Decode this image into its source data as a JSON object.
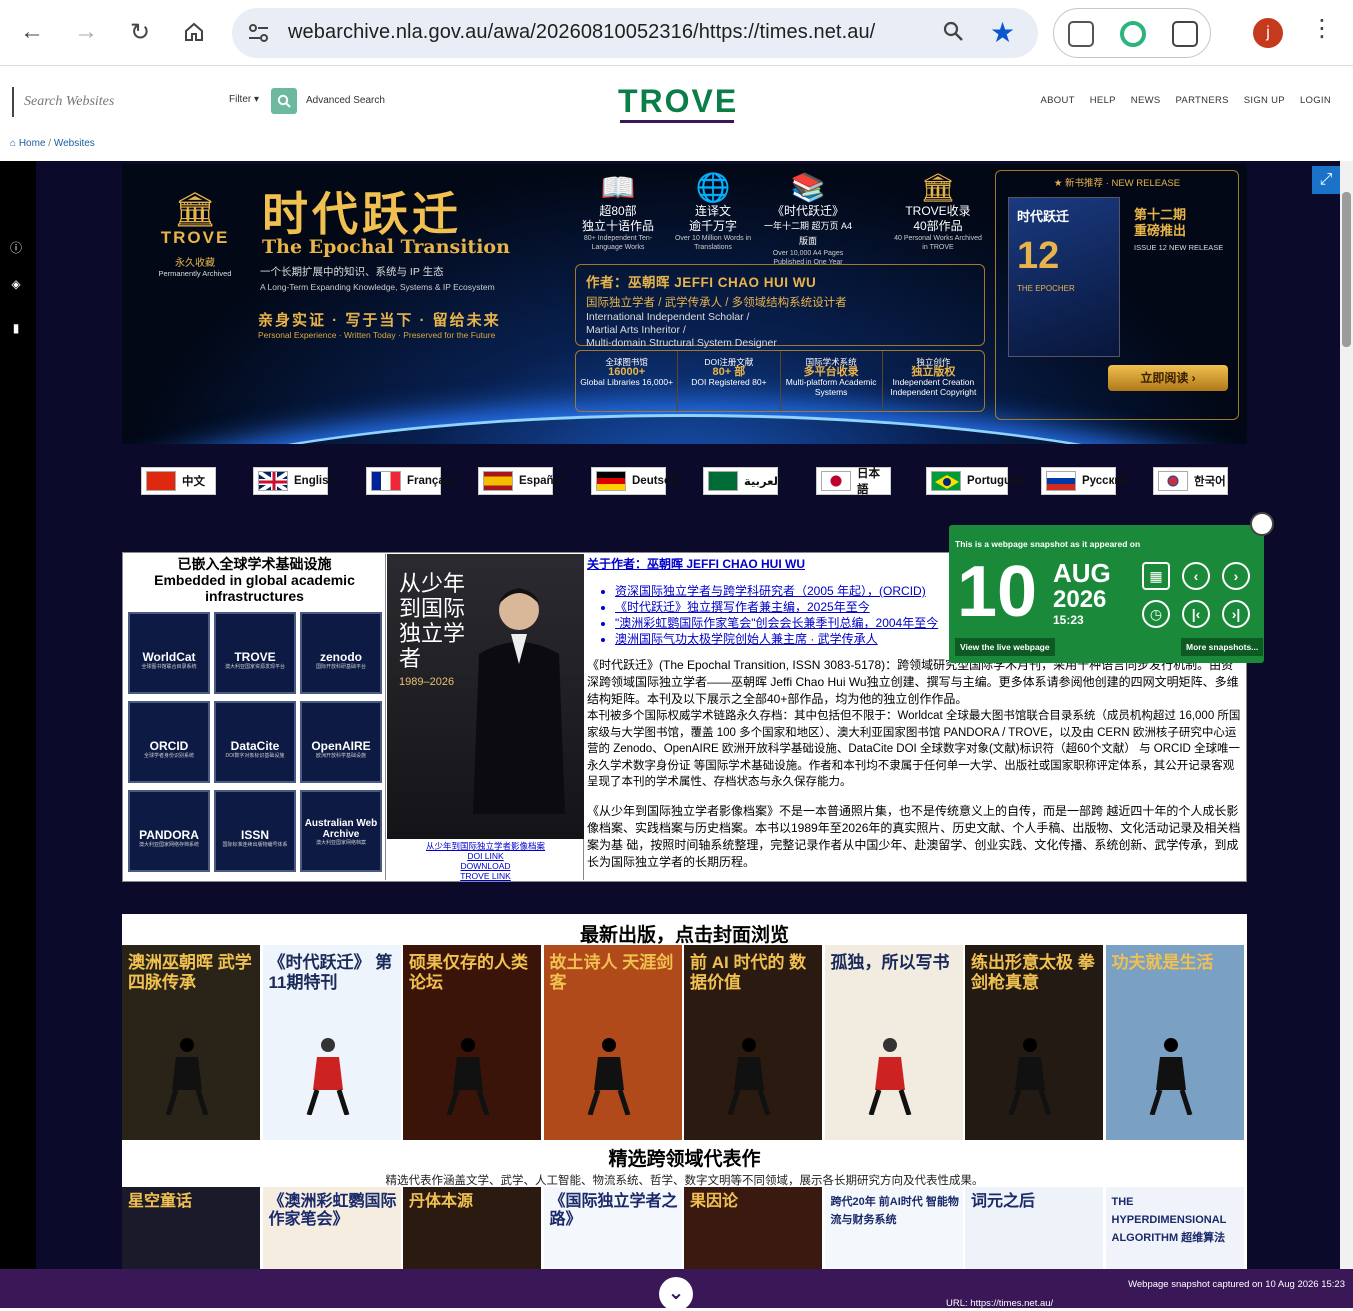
{
  "browser": {
    "url": "webarchive.nla.gov.au/awa/20260810052316/https://times.net.au/",
    "avatar_letter": "j",
    "accent": "#0b57d0"
  },
  "trove_header": {
    "search_placeholder": "Search Websites",
    "filter_label": "Filter ▾",
    "advanced_search": "Advanced Search",
    "logo": "TROVE",
    "nav": [
      "ABOUT",
      "HELP",
      "NEWS",
      "PARTNERS",
      "SIGN UP",
      "LOGIN"
    ],
    "breadcrumb_home": "Home",
    "breadcrumb_sep": "/",
    "breadcrumb_websites": "Websites"
  },
  "banner": {
    "trove_label": "TROVE",
    "trove_cn": "永久收藏",
    "trove_en": "Permanently Archived",
    "title_cn": "时代跃迁",
    "title_en": "The Epochal Transition",
    "subtitle_cn": "一个长期扩展中的知识、系统与 IP 生态",
    "subtitle_en": "A Long-Term Expanding Knowledge, Systems & IP Ecosystem",
    "motto_cn": "亲身实证 · 写于当下 · 留给未来",
    "motto_en": "Personal Experience · Written Today · Preserved for the Future",
    "stats": [
      {
        "l1a": "超80部",
        "l1b": "独立十语作品",
        "l2": "80+ Independent Ten-Language Works"
      },
      {
        "l1a": "连译文",
        "l1b": "逾千万字",
        "l2": "Over 10 Million Words in Translations"
      },
      {
        "l1a": "《时代跃迁》",
        "l1b": "一年十二期 超万页 A4 版面",
        "l2": "Over 10,000 A4 Pages Published in One Year"
      },
      {
        "l1a": "TROVE收录",
        "l1b": "40部作品",
        "l2": "40 Personal Works Archived in TROVE"
      }
    ],
    "author_name": "作者：巫朝晖  JEFFI CHAO HUI WU",
    "author_roles": "国际独立学者 / 武学传承人 / 多领域结构系统设计者",
    "author_en1": "International Independent Scholar /",
    "author_en2": "Martial Arts Inheritor /",
    "author_en3": "Multi-domain Structural System Designer",
    "bottom_stats": [
      {
        "a": "全球图书馆",
        "b": "16000+",
        "c": "Global Libraries 16,000+"
      },
      {
        "a": "DOI注册文献",
        "b": "80+ 部",
        "c": "DOI Registered 80+"
      },
      {
        "a": "国际学术系统",
        "b": "多平台收录",
        "c": "Multi-platform Academic Systems"
      },
      {
        "a": "独立创作",
        "b": "独立版权",
        "c": "Independent Creation Independent Copyright"
      }
    ],
    "new_release": "★ 新书推荐 · NEW RELEASE",
    "book_title": "时代跃迁",
    "book_num": "12",
    "book_sub": "THE EPOCHER",
    "issue_cn1": "第十二期",
    "issue_cn2": "重磅推出",
    "issue_en": "ISSUE 12 NEW RELEASE",
    "read_now": "立即阅读 ›"
  },
  "languages": [
    "中文",
    "English",
    "Français",
    "Español",
    "Deutsch",
    "العربية",
    "日本語",
    "Português",
    "Русский",
    "한국어"
  ],
  "embed": {
    "heading_cn": "已嵌入全球学术基础设施",
    "heading_en": "Embedded in global academic infrastructures",
    "items": [
      {
        "name": "WorldCat",
        "cn": "全球图书馆联合目录系统",
        "sub": "OCLC"
      },
      {
        "name": "TROVE",
        "cn": "澳大利亚国家资源发现平台",
        "sub": "National Library of Australia"
      },
      {
        "name": "zenodo",
        "cn": "国际开放科研基础平台",
        "sub": "Operated by CERN"
      },
      {
        "name": "ORCID",
        "cn": "全球学者身份识别系统",
        "sub": "ORCID"
      },
      {
        "name": "DataCite",
        "cn": "DOI数字对象标识基础设施",
        "sub": "DataCite"
      },
      {
        "name": "OpenAIRE",
        "cn": "欧洲开放科学基础设施",
        "sub": "OpenAIRE"
      },
      {
        "name": "PANDORA",
        "cn": "澳大利亚国家网络存档系统",
        "sub": "National Library of Australia"
      },
      {
        "name": "ISSN",
        "cn": "国际标准连续出版物编号体系",
        "sub": "ISSN International Centre"
      },
      {
        "name": "Australian Web Archive",
        "cn": "澳大利亚国家网络档案",
        "sub": "National Library of Australia"
      }
    ]
  },
  "book": {
    "title": "从少年到国际独立学者",
    "years": "1989–2026",
    "links": [
      "从少年到国际独立学者影像档案",
      "DOI LINK",
      "DOWNLOAD",
      "TROVE LINK"
    ]
  },
  "about": {
    "title": "关于作者：巫朝晖 JEFFI CHAO HUI WU",
    "bullets": [
      "资深国际独立学者与跨学科研究者（2005 年起），(ORCID)",
      "《时代跃迁》独立撰写作者兼主编，2025年至今",
      "\"澳洲彩虹鹦国际作家笔会\"创会会长兼季刊总编，2004年至今",
      "澳洲国际气功太极学院创始人兼主席 · 武学传承人"
    ],
    "p1": "《时代跃迁》(The Epochal Transition, ISSN 3083-5178)：跨领域研究型国际学术月刊，采用十种语言同步发行机制。由资深跨领域国际独立学者——巫朝晖 Jeffi Chao Hui Wu独立创建、撰写与主编。更多体系请参阅他创建的四网文明矩阵、多维结构矩阵。本刊及以下展示之全部40+部作品，均为他的独立创作作品。",
    "p2": "本刊被多个国际权威学术链路永久存档：其中包括但不限于：Worldcat 全球最大图书馆联合目录系统（成员机构超过 16,000 所国家级与大学图书馆，覆盖 100 多个国家和地区）、澳大利亚国家图书馆 PANDORA / TROVE，以及由 CERN 欧洲核子研究中心运营的 Zenodo、OpenAIRE 欧洲开放科学基础设施、DataCite DOI 全球数字对象(文献)标识符（超60个文献） 与 ORCID 全球唯一永久学术数字身份证 等国际学术基础设施。作者和本刊均不隶属于任何单一大学、出版社或国家职称评定体系，其公开记录客观呈现了本刊的学术属性、存档状态与永久保存能力。",
    "p3": "《从少年到国际独立学者影像档案》不是一本普通照片集，也不是传统意义上的自传，而是一部跨 越近四十年的个人成长影像档案、实践档案与历史档案。本书以1989年至2026年的真实照片、历史文献、个人手稿、出版物、文化活动记录及相关档案为基 础，按照时间轴系统整理，完整记录作者从中国少年、赴澳留学、创业实践、文化传播、系统创新、武学传承，到成长为国际独立学者的长期历程。"
  },
  "snapshot": {
    "heading": "This is a webpage snapshot as it appeared on",
    "day": "10",
    "month": "AUG",
    "year": "2026",
    "time": "15:23",
    "live": "View the live webpage",
    "more": "More snapshots..."
  },
  "latest": {
    "heading": "最新出版，点击封面浏览",
    "covers": [
      {
        "title": "澳洲巫朝晖 武学四脉传承",
        "bg": "#2a2418"
      },
      {
        "title": "《时代跃迁》 第11期特刊",
        "bg": "#eef4fb"
      },
      {
        "title": "硕果仅存的人类论坛",
        "bg": "#3a1408"
      },
      {
        "title": "故土诗人 天涯剑客",
        "bg": "#b04a1a"
      },
      {
        "title": "前 AI 时代的 数据价值",
        "bg": "#2a1a10"
      },
      {
        "title": "孤独，所以写书",
        "bg": "#f2ebe0"
      },
      {
        "title": "练出形意太极 拳剑枪真意",
        "bg": "#241a14"
      },
      {
        "title": "功夫就是生活",
        "bg": "#7aa0c4"
      }
    ],
    "heading2": "精选跨领域代表作",
    "subheading": "精选代表作涵盖文学、武学、人工智能、物流系统、哲学、数字文明等不同领域，展示各长期研究方向及代表性成果。",
    "covers2": [
      {
        "title": "星空童话",
        "bg": "#1a1a2a"
      },
      {
        "title": "《澳洲彩虹鹦国际作家笔会》",
        "bg": "#f4ede0"
      },
      {
        "title": "丹体本源",
        "bg": "#2a1a10"
      },
      {
        "title": "《国际独立学者之路》",
        "bg": "#f4f7fc"
      },
      {
        "title": "果因论",
        "bg": "#3a1a10"
      },
      {
        "title": "跨代20年 前AI时代 智能物流与财务系统",
        "bg": "#f4f8fc"
      },
      {
        "title": "词元之后",
        "bg": "#eef3fa"
      },
      {
        "title": "THE HYPERDIMENSIONAL ALGORITHM 超维算法",
        "bg": "#f0f4fa"
      }
    ]
  },
  "footer": {
    "captured": "Webpage snapshot captured on 10 Aug 2026 15:23",
    "url": "URL: https://times.net.au/"
  }
}
